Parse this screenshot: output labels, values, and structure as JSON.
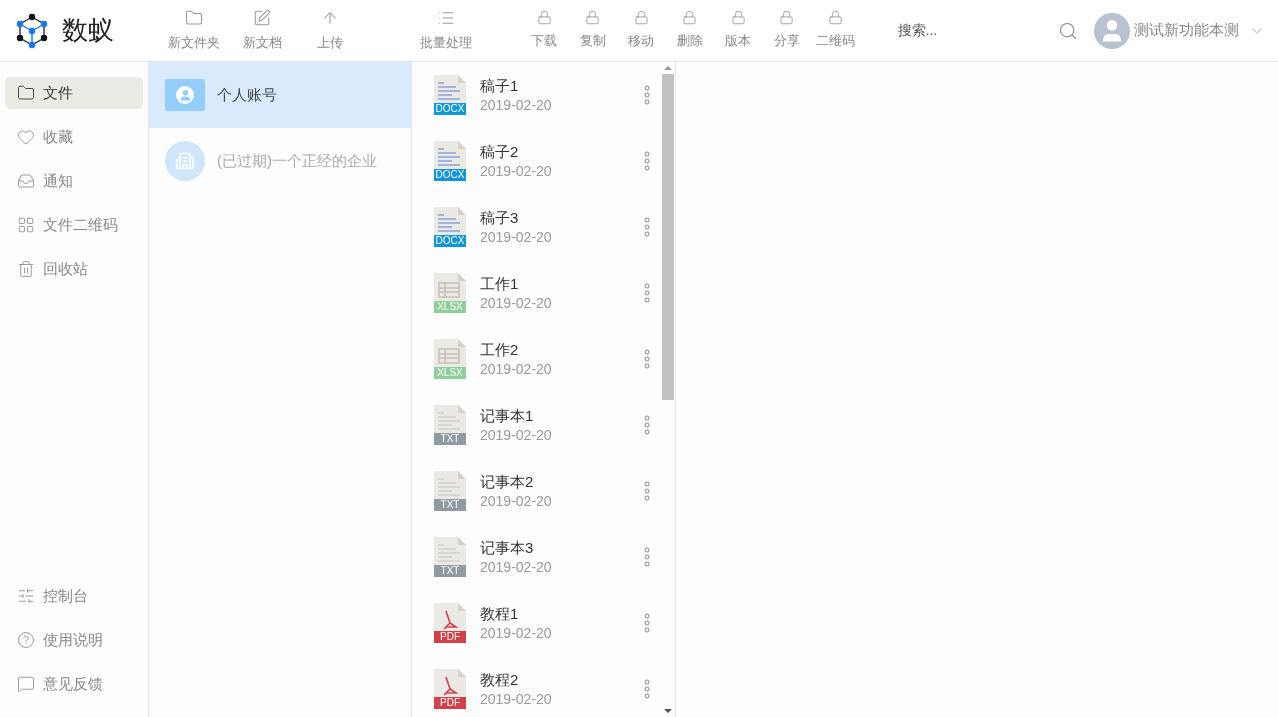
{
  "logo": {
    "name": "数蚁"
  },
  "toolbar": [
    {
      "label": "新文件夹",
      "kind": "folder"
    },
    {
      "label": "新文档",
      "kind": "edit"
    },
    {
      "label": "上传",
      "kind": "upload"
    },
    {
      "label": "批量处理",
      "kind": "batch"
    },
    {
      "label": "下载",
      "kind": "locked"
    },
    {
      "label": "复制",
      "kind": "locked"
    },
    {
      "label": "移动",
      "kind": "locked"
    },
    {
      "label": "删除",
      "kind": "locked"
    },
    {
      "label": "版本",
      "kind": "locked"
    },
    {
      "label": "分享",
      "kind": "locked"
    },
    {
      "label": "二维码",
      "kind": "locked"
    }
  ],
  "search": {
    "placeholder": "搜索..."
  },
  "user": {
    "name": "测试新功能本测"
  },
  "sidebar": {
    "items": [
      {
        "label": "文件",
        "kind": "folder",
        "selected": true
      },
      {
        "label": "收藏",
        "kind": "heart",
        "selected": false
      },
      {
        "label": "通知",
        "kind": "inbox",
        "selected": false
      },
      {
        "label": "文件二维码",
        "kind": "qr",
        "selected": false
      },
      {
        "label": "回收站",
        "kind": "trash",
        "selected": false
      }
    ],
    "bottom_items": [
      {
        "label": "控制台",
        "kind": "console"
      },
      {
        "label": "使用说明",
        "kind": "help"
      },
      {
        "label": "意见反馈",
        "kind": "feedback"
      }
    ]
  },
  "accounts": [
    {
      "name": "个人账号",
      "kind": "personal",
      "selected": true,
      "disabled": false
    },
    {
      "name": "(已过期)一个正经的企业",
      "kind": "enterprise",
      "selected": false,
      "disabled": true
    }
  ],
  "files": [
    {
      "name": "稿子1",
      "date": "2019-02-20",
      "kind": "docx",
      "badge": "DOCX"
    },
    {
      "name": "稿子2",
      "date": "2019-02-20",
      "kind": "docx",
      "badge": "DOCX"
    },
    {
      "name": "稿子3",
      "date": "2019-02-20",
      "kind": "docx",
      "badge": "DOCX"
    },
    {
      "name": "工作1",
      "date": "2019-02-20",
      "kind": "xlsx",
      "badge": "XLSX"
    },
    {
      "name": "工作2",
      "date": "2019-02-20",
      "kind": "xlsx",
      "badge": "XLSX"
    },
    {
      "name": "记事本1",
      "date": "2019-02-20",
      "kind": "txt",
      "badge": "TXT"
    },
    {
      "name": "记事本2",
      "date": "2019-02-20",
      "kind": "txt",
      "badge": "TXT"
    },
    {
      "name": "记事本3",
      "date": "2019-02-20",
      "kind": "txt",
      "badge": "TXT"
    },
    {
      "name": "教程1",
      "date": "2019-02-20",
      "kind": "pdf",
      "badge": "PDF"
    },
    {
      "name": "教程2",
      "date": "2019-02-20",
      "kind": "pdf",
      "badge": "PDF"
    }
  ]
}
